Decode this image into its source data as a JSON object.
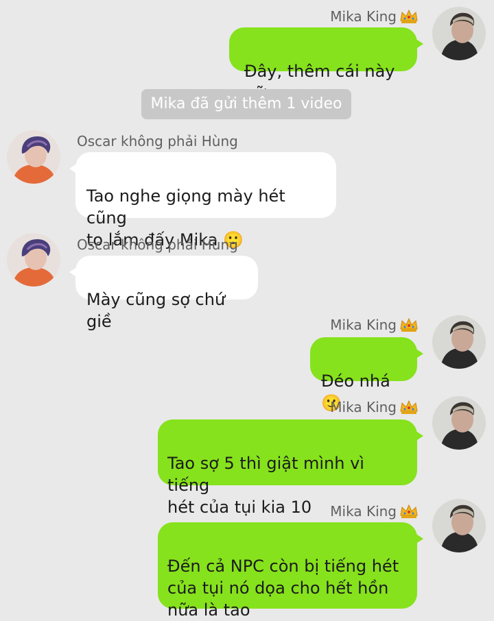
{
  "chat": {
    "system_message": "Mika đã gửi thêm 1 video",
    "messages": [
      {
        "sender": "Mika King",
        "text": "Đây, thêm cái này nữa"
      },
      {
        "sender": "Oscar không phải Hùng",
        "text": "Tao nghe giọng mày hét cũng\nto lắm đấy Mika 🙂"
      },
      {
        "sender": "Oscar không phải Hùng",
        "text": "Mày cũng sợ chứ giề"
      },
      {
        "sender": "Mika King",
        "text": "Đéo nhá 🙂"
      },
      {
        "sender": "Mika King",
        "text": "Tao sợ 5 thì giật mình vì tiếng\nhét của tụi kia 10"
      },
      {
        "sender": "Mika King",
        "text": "Đến cả NPC còn bị tiếng hét\ncủa tụi nó dọa cho hết hồn\nnữa là tao"
      }
    ]
  },
  "colors": {
    "background": "#e9e9e9",
    "outgoing_bubble": "#86e21c",
    "incoming_bubble": "#ffffff",
    "system_pill": "#c8c8c8"
  },
  "icons": {
    "crown": "crown-icon",
    "avatar_mika": "avatar-mika",
    "avatar_oscar": "avatar-oscar"
  }
}
